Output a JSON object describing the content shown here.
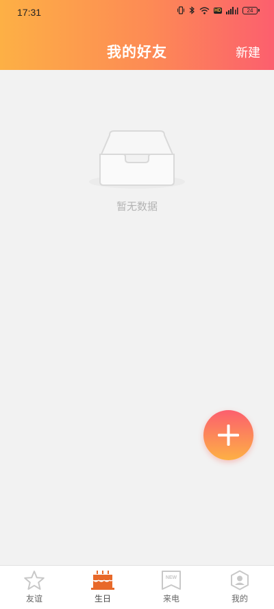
{
  "status_bar": {
    "time": "17:31",
    "network_badge": "HD",
    "battery_level": "24"
  },
  "header": {
    "title": "我的好友",
    "new_label": "新建"
  },
  "empty_state": {
    "message": "暂无数据",
    "icon": "empty-inbox-icon"
  },
  "fab": {
    "icon": "plus-icon"
  },
  "tabbar": {
    "items": [
      {
        "label": "友谊",
        "icon": "star-icon",
        "active": false
      },
      {
        "label": "生日",
        "icon": "birthday-cake-icon",
        "active": true
      },
      {
        "label": "来电",
        "icon": "new-tag-icon",
        "active": false
      },
      {
        "label": "我的",
        "icon": "profile-icon",
        "active": false
      }
    ],
    "active_color": "#e8692a",
    "inactive_color": "#c8c8c8"
  },
  "colors": {
    "header_gradient_start": "#fdb045",
    "header_gradient_end": "#fc5f6e",
    "background": "#f2f2f2"
  }
}
